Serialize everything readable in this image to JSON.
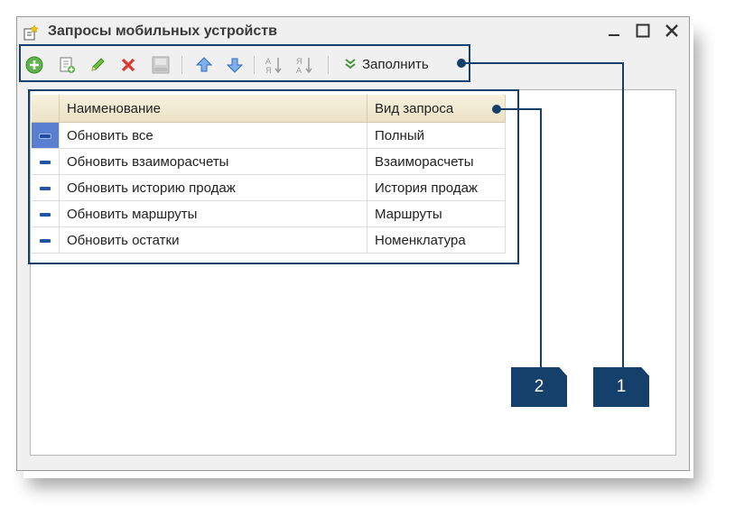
{
  "window": {
    "title": "Запросы мобильных устройств",
    "controls": [
      "minimize",
      "maximize",
      "close"
    ]
  },
  "toolbar": {
    "buttons": [
      {
        "icon": "add-circle-icon"
      },
      {
        "icon": "copy-document-icon"
      },
      {
        "icon": "edit-pencil-icon"
      },
      {
        "icon": "delete-x-icon"
      },
      {
        "icon": "post-document-icon"
      },
      {
        "icon": "move-up-icon"
      },
      {
        "icon": "move-down-icon"
      },
      {
        "icon": "sort-ascending-icon"
      },
      {
        "icon": "sort-descending-icon"
      }
    ],
    "fill_label": "Заполнить"
  },
  "table": {
    "columns": [
      "",
      "Наименование",
      "Вид запроса"
    ],
    "rows": [
      {
        "name": "Обновить все",
        "type": "Полный",
        "selected": true
      },
      {
        "name": "Обновить взаиморасчеты",
        "type": "Взаиморасчеты",
        "selected": false
      },
      {
        "name": "Обновить историю продаж",
        "type": "История продаж",
        "selected": false
      },
      {
        "name": "Обновить маршруты",
        "type": "Маршруты",
        "selected": false
      },
      {
        "name": "Обновить остатки",
        "type": "Номенклатура",
        "selected": false
      }
    ]
  },
  "callouts": {
    "badge1": "1",
    "badge2": "2"
  },
  "colors": {
    "callout": "#15406b",
    "header": "#ece3c6",
    "selection": "#5a7fd1"
  }
}
